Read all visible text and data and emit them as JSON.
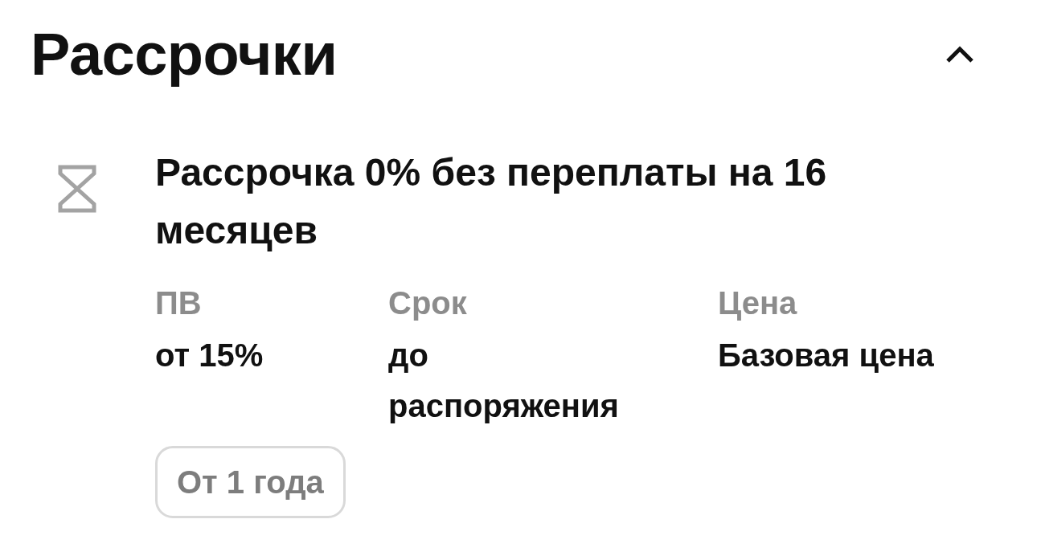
{
  "section": {
    "title": "Рассрочки",
    "expanded": true
  },
  "plans": [
    {
      "title": "Рассрочка 0% без переплаты на 16 месяцев",
      "details": [
        {
          "label": "ПВ",
          "value": "от 15%"
        },
        {
          "label": "Срок",
          "value": "до распоряжения"
        },
        {
          "label": "Цена",
          "value": "Базовая цена"
        }
      ],
      "tags": [
        "От 1 года"
      ]
    }
  ]
}
